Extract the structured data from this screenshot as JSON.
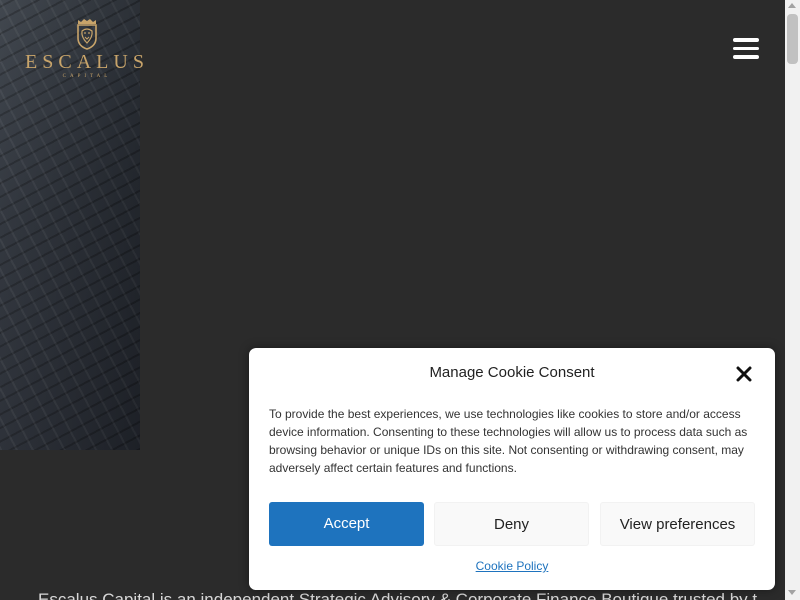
{
  "brand": {
    "name": "ESCALUS",
    "tagline": "CAPITAL",
    "accent_color": "#c8a46a"
  },
  "header": {
    "menu_icon": "hamburger-menu-icon"
  },
  "background_content": {
    "heading_fragment": "",
    "paragraph": "Escalus Capital is an independent Strategic Advisory & Corporate Finance Boutique trusted by the"
  },
  "cookie_banner": {
    "title": "Manage Cookie Consent",
    "close_icon": "close-icon",
    "message": "To provide the best experiences, we use technologies like cookies to store and/or access device information. Consenting to these technologies will allow us to process data such as browsing behavior or unique IDs on this site. Not consenting or withdrawing consent, may adversely affect certain features and functions.",
    "buttons": {
      "accept": "Accept",
      "deny": "Deny",
      "view_preferences": "View preferences"
    },
    "policy_link": "Cookie Policy",
    "accept_color": "#1e73be"
  }
}
